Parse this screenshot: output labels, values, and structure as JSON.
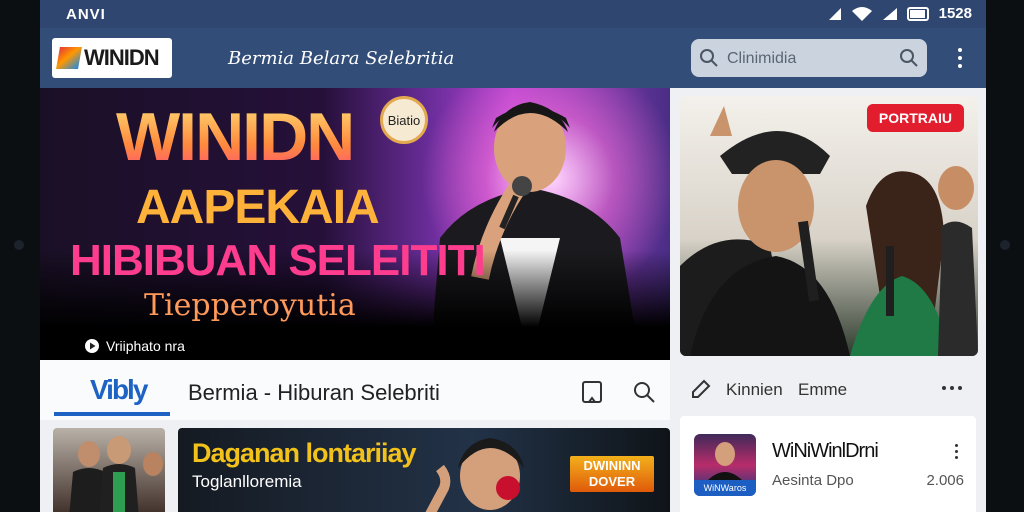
{
  "status_bar": {
    "carrier": "ANVI",
    "time": "1528"
  },
  "app_bar": {
    "logo_text": "WINIDN",
    "app_name": "Bermia Belara Selebritia",
    "search_placeholder": "Clinimidia"
  },
  "hero": {
    "title_line1": "WINIDN",
    "title_line2": "AAPEKAIA",
    "title_line3": "HIBIBUAN SELEITITI",
    "title_line4": "Tiepperoyutia",
    "caption": "Vriiphato nra",
    "round_badge": "Biatio"
  },
  "featured_card": {
    "badge": "PORTRAIU"
  },
  "section": {
    "tab_label": "Vibly",
    "title": "Bermia - Hiburan Selebriti"
  },
  "right_header": {
    "label1": "Kinnien",
    "label2": "Emme"
  },
  "thumbnail_large": {
    "title": "Daganan lontariiay",
    "subtitle": "Toglanlloremia",
    "badge_line1": "DWININN",
    "badge_line2": "DOVER"
  },
  "list_item": {
    "title": "WiNiWinlDrni",
    "subtitle": "Aesinta Dpo",
    "count": "2.006",
    "thumb_label": "WiNWaros"
  },
  "colors": {
    "status_bar": "#2e4670",
    "app_bar": "#324d78",
    "accent": "#1e63c4",
    "badge_red": "#e11d2e"
  }
}
